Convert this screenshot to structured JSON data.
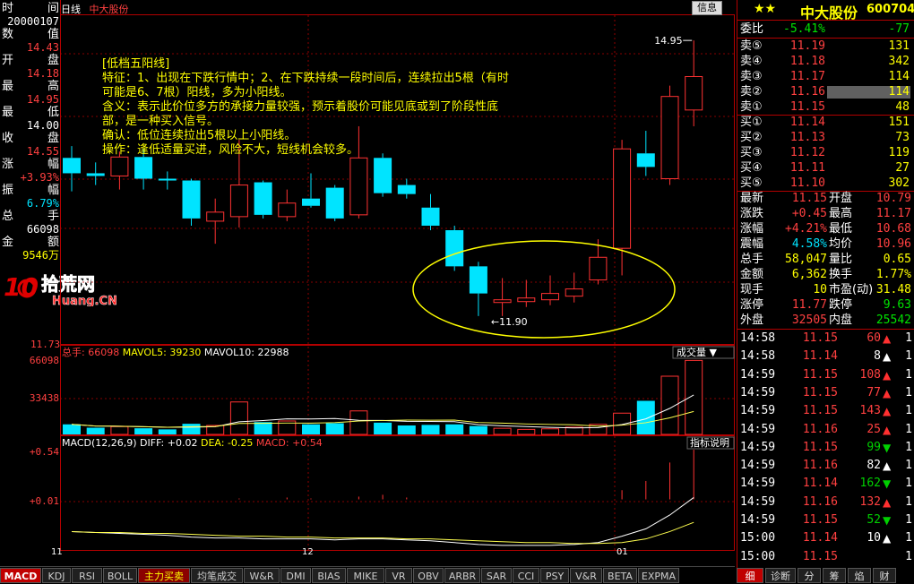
{
  "window": {
    "period": "日线",
    "stock_name": "中大股份",
    "info_button": "信息"
  },
  "left_info": {
    "rows": [
      {
        "label": "时",
        "label2": "间",
        "value": "20000107"
      },
      {
        "label": "数",
        "label2": "值",
        "value": "14.43"
      },
      {
        "label": "开",
        "label2": "盘",
        "value": "14.18"
      },
      {
        "label": "最",
        "label2": "高",
        "value": "14.95"
      },
      {
        "label": "最",
        "label2": "低",
        "value": "14.00"
      },
      {
        "label": "收",
        "label2": "盘",
        "value": "14.55"
      },
      {
        "label": "涨",
        "label2": "幅",
        "value": "+3.93%"
      },
      {
        "label": "振",
        "label2": "幅",
        "value": "6.79%"
      },
      {
        "label": "总",
        "label2": "手",
        "value": "66098"
      },
      {
        "label": "金",
        "label2": "额",
        "value": "9546万"
      }
    ]
  },
  "watermark": {
    "logo_text": "10拾荒网",
    "sub": "Huang.CN"
  },
  "annotation": {
    "lines": [
      "[低档五阳线]",
      "特征：1、出现在下跌行情中；2、在下跌持续一段时间后，连续拉出5根（有时",
      "可能是6、7根）阳线，多为小阳线。",
      "含义：表示此价位多方的承接力量较强，预示着股价可能见底或到了阶段性底",
      "部，是一种买入信号。",
      "确认：低位连续拉出5根以上小阳线。",
      "操作：逢低适量买进，风险不大，短线机会较多。"
    ]
  },
  "price_chart": {
    "high_label": "14.95",
    "low_label": "11.90",
    "axis_bottom": "11.73",
    "ymin": 11.73,
    "ymax": 15.1,
    "candles": [
      {
        "o": 13.65,
        "h": 13.78,
        "l": 13.28,
        "c": 13.48
      },
      {
        "o": 13.48,
        "h": 13.6,
        "l": 13.35,
        "c": 13.45
      },
      {
        "o": 13.45,
        "h": 13.72,
        "l": 13.3,
        "c": 13.66
      },
      {
        "o": 13.66,
        "h": 13.75,
        "l": 13.3,
        "c": 13.42
      },
      {
        "o": 13.42,
        "h": 13.5,
        "l": 13.3,
        "c": 13.4
      },
      {
        "o": 13.4,
        "h": 13.42,
        "l": 12.9,
        "c": 12.98
      },
      {
        "o": 12.95,
        "h": 13.2,
        "l": 12.7,
        "c": 13.05
      },
      {
        "o": 13.0,
        "h": 13.85,
        "l": 12.88,
        "c": 13.35
      },
      {
        "o": 13.38,
        "h": 13.4,
        "l": 12.98,
        "c": 13.02
      },
      {
        "o": 13.0,
        "h": 13.3,
        "l": 12.95,
        "c": 13.15
      },
      {
        "o": 13.2,
        "h": 13.48,
        "l": 13.1,
        "c": 13.12
      },
      {
        "o": 13.32,
        "h": 13.35,
        "l": 12.95,
        "c": 12.98
      },
      {
        "o": 13.02,
        "h": 14.0,
        "l": 12.98,
        "c": 13.65
      },
      {
        "o": 13.65,
        "h": 13.7,
        "l": 13.22,
        "c": 13.26
      },
      {
        "o": 13.35,
        "h": 13.42,
        "l": 13.2,
        "c": 13.25
      },
      {
        "o": 13.1,
        "h": 13.25,
        "l": 12.85,
        "c": 12.9
      },
      {
        "o": 12.85,
        "h": 12.9,
        "l": 12.4,
        "c": 12.45
      },
      {
        "o": 12.45,
        "h": 12.5,
        "l": 11.9,
        "c": 12.15
      },
      {
        "o": 12.05,
        "h": 12.32,
        "l": 11.9,
        "c": 12.08
      },
      {
        "o": 12.06,
        "h": 12.3,
        "l": 12.0,
        "c": 12.1
      },
      {
        "o": 12.08,
        "h": 12.35,
        "l": 12.02,
        "c": 12.15
      },
      {
        "o": 12.12,
        "h": 12.38,
        "l": 12.05,
        "c": 12.2
      },
      {
        "o": 12.3,
        "h": 12.75,
        "l": 12.25,
        "c": 12.55
      },
      {
        "o": 12.65,
        "h": 13.85,
        "l": 12.35,
        "c": 13.75
      },
      {
        "o": 13.7,
        "h": 13.95,
        "l": 13.45,
        "c": 13.55
      },
      {
        "o": 13.42,
        "h": 14.45,
        "l": 13.35,
        "c": 14.33
      },
      {
        "o": 14.18,
        "h": 14.95,
        "l": 14.0,
        "c": 14.55
      }
    ]
  },
  "volume_chart": {
    "legend_label": "总手:",
    "legend_value": "66098",
    "mavol5_label": "MAVOL5:",
    "mavol5_value": "39230",
    "mavol10_label": "MAVOL10:",
    "mavol10_value": "22988",
    "title_button": "成交量",
    "axis_top": "66098",
    "axis_mid": "33438",
    "values": [
      9000,
      6000,
      7000,
      5500,
      4500,
      9500,
      8000,
      29000,
      11000,
      12000,
      9000,
      10000,
      21000,
      10500,
      8000,
      8500,
      9000,
      7500,
      5500,
      4500,
      5000,
      6500,
      9000,
      19000,
      30000,
      52000,
      66098
    ],
    "ymax": 68000
  },
  "macd_chart": {
    "legend": "MACD(12,26,9)",
    "diff_label": "DIFF:",
    "diff_value": "+0.02",
    "dea_label": "DEA:",
    "dea_value": "-0.25",
    "macd_label": "MACD:",
    "macd_value": "+0.54",
    "help_button": "指标说明",
    "axis_top": "+0.54",
    "axis_mid": "+0.01",
    "diff": [
      -0.35,
      -0.36,
      -0.37,
      -0.38,
      -0.39,
      -0.41,
      -0.42,
      -0.42,
      -0.43,
      -0.43,
      -0.43,
      -0.44,
      -0.43,
      -0.43,
      -0.44,
      -0.45,
      -0.47,
      -0.49,
      -0.5,
      -0.5,
      -0.5,
      -0.49,
      -0.47,
      -0.4,
      -0.32,
      -0.17,
      0.02
    ],
    "dea": [
      -0.35,
      -0.36,
      -0.36,
      -0.37,
      -0.37,
      -0.38,
      -0.39,
      -0.4,
      -0.4,
      -0.41,
      -0.41,
      -0.42,
      -0.42,
      -0.42,
      -0.43,
      -0.43,
      -0.44,
      -0.45,
      -0.46,
      -0.47,
      -0.47,
      -0.48,
      -0.48,
      -0.47,
      -0.43,
      -0.35,
      -0.25
    ],
    "bars": [
      0.0,
      0.0,
      0.0,
      0.0,
      0.0,
      0.0,
      0.0,
      0.01,
      0.0,
      0.02,
      0.01,
      0.0,
      0.03,
      0.05,
      0.02,
      0.0,
      0.0,
      0.0,
      0.0,
      0.0,
      0.0,
      0.0,
      0.0,
      0.1,
      0.2,
      0.4,
      0.54
    ],
    "ymin": -0.55,
    "ymax": 0.56
  },
  "date_axis": {
    "labels": [
      "11",
      "12",
      "01"
    ]
  },
  "bottom_tabs": [
    "MACD",
    "KDJ",
    "RSI",
    "BOLL",
    "主力买卖",
    "均笔成交",
    "W&R",
    "DMI",
    "BIAS",
    "MIKE",
    "VR",
    "OBV",
    "ARBR",
    "SAR",
    "CCI",
    "PSY",
    "V&R",
    "BETA",
    "EXPMA"
  ],
  "quote": {
    "stars": "★★",
    "name": "中大股份",
    "code": "600704",
    "weibi_label": "委比",
    "weibi_value": "-5.41%",
    "weicha_value": "-77",
    "sells": [
      {
        "label": "卖⑤",
        "price": "11.19",
        "vol": "131"
      },
      {
        "label": "卖④",
        "price": "11.18",
        "vol": "342"
      },
      {
        "label": "卖③",
        "price": "11.17",
        "vol": "114"
      },
      {
        "label": "卖②",
        "price": "11.16",
        "vol": "114"
      },
      {
        "label": "卖①",
        "price": "11.15",
        "vol": "48"
      }
    ],
    "buys": [
      {
        "label": "买①",
        "price": "11.14",
        "vol": "151"
      },
      {
        "label": "买②",
        "price": "11.13",
        "vol": "73"
      },
      {
        "label": "买③",
        "price": "11.12",
        "vol": "119"
      },
      {
        "label": "买④",
        "price": "11.11",
        "vol": "27"
      },
      {
        "label": "买⑤",
        "price": "11.10",
        "vol": "302"
      }
    ],
    "stats": [
      {
        "l1": "最新",
        "v1": "11.15",
        "l2": "开盘",
        "v2": "10.79"
      },
      {
        "l1": "涨跌",
        "v1": "+0.45",
        "l2": "最高",
        "v2": "11.17"
      },
      {
        "l1": "涨幅",
        "v1": "+4.21%",
        "l2": "最低",
        "v2": "10.68"
      },
      {
        "l1": "震幅",
        "v1": "4.58%",
        "l2": "均价",
        "v2": "10.96"
      },
      {
        "l1": "总手",
        "v1": "58,047",
        "l2": "量比",
        "v2": "0.65"
      },
      {
        "l1": "金额",
        "v1": "6,362",
        "l2": "换手",
        "v2": "1.77%"
      },
      {
        "l1": "现手",
        "v1": "10",
        "l2": "市盈(动)",
        "v2": "31.48"
      },
      {
        "l1": "涨停",
        "v1": "11.77",
        "l2": "跌停",
        "v2": "9.63"
      },
      {
        "l1": "外盘",
        "v1": "32505",
        "l2": "内盘",
        "v2": "25542"
      }
    ],
    "ticks": [
      {
        "time": "14:58",
        "price": "11.15",
        "vol": "60",
        "dir": "up",
        "n": "1"
      },
      {
        "time": "14:58",
        "price": "11.14",
        "vol": "8",
        "dir": "up-w",
        "n": "1"
      },
      {
        "time": "14:59",
        "price": "11.15",
        "vol": "108",
        "dir": "up",
        "n": "1"
      },
      {
        "time": "14:59",
        "price": "11.15",
        "vol": "77",
        "dir": "up",
        "n": "1"
      },
      {
        "time": "14:59",
        "price": "11.15",
        "vol": "143",
        "dir": "up",
        "n": "1"
      },
      {
        "time": "14:59",
        "price": "11.16",
        "vol": "25",
        "dir": "up",
        "n": "1"
      },
      {
        "time": "14:59",
        "price": "11.15",
        "vol": "99",
        "dir": "down",
        "n": "1"
      },
      {
        "time": "14:59",
        "price": "11.16",
        "vol": "82",
        "dir": "up-w",
        "n": "1"
      },
      {
        "time": "14:59",
        "price": "11.14",
        "vol": "162",
        "dir": "down",
        "n": "1"
      },
      {
        "time": "14:59",
        "price": "11.16",
        "vol": "132",
        "dir": "up",
        "n": "1"
      },
      {
        "time": "14:59",
        "price": "11.15",
        "vol": "52",
        "dir": "down",
        "n": "1"
      },
      {
        "time": "15:00",
        "price": "11.14",
        "vol": "10",
        "dir": "up-w",
        "n": "1"
      },
      {
        "time": "15:00",
        "price": "11.15",
        "vol": "",
        "dir": "",
        "n": "1"
      }
    ],
    "bottom_tabs": [
      "细",
      "诊断",
      "分",
      "筹",
      "焰",
      "财"
    ]
  },
  "colors": {
    "up": "#ff3232",
    "down": "#00e4ff",
    "yellow": "#ffff00",
    "grid": "#b30000",
    "ma_white": "#ffffff",
    "ma_yellow": "#ffff4f",
    "green_arrow": "#00d000"
  }
}
